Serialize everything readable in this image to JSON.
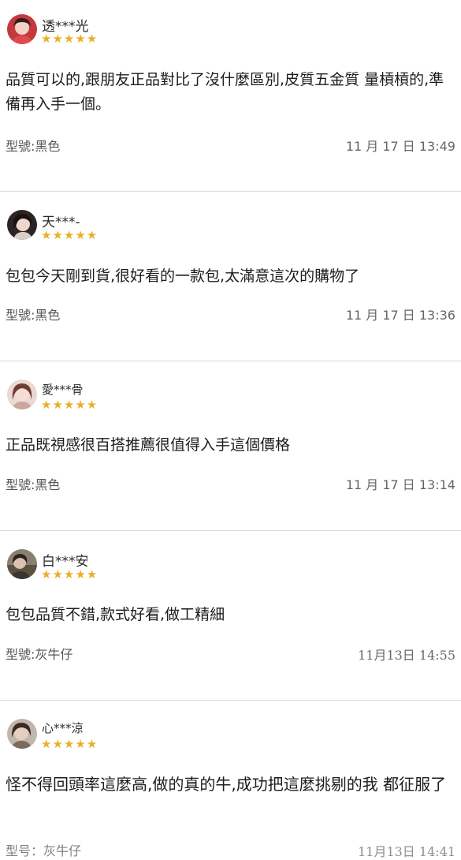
{
  "reviews": [
    {
      "username": "透***光",
      "stars": "★★★★★",
      "content": "品質可以的,跟朋友正品對比了沒什麼區別,皮質五金質 量槓槓的,準備再入手一個。",
      "model": "型號:黑色",
      "time": "11 月 17 日 13:49"
    },
    {
      "username": "天***-",
      "stars": "★★★★★",
      "content": "包包今天剛到貨,很好看的一款包,太滿意這次的購物了",
      "model": "型號:黑色",
      "time": "11 月 17 日 13:36"
    },
    {
      "username": "愛***骨",
      "stars": "★★★★★",
      "content": "正品既視感很百搭推薦很值得入手這個價格",
      "model": "型號:黑色",
      "time": "11 月 17 日 13:14"
    },
    {
      "username": "白***安",
      "stars": "★★★★★",
      "content": "包包品質不錯,款式好看,做工精細",
      "model": "型號:灰牛仔",
      "time": "11月13日 14:55"
    },
    {
      "username": "心***涼",
      "stars": "★★★★★",
      "content": "怪不得回頭率這麼高,做的真的牛,成功把這麼挑剔的我 都征服了",
      "model": "型号：灰牛仔",
      "time": "11月13日 14:41"
    }
  ],
  "colors": {
    "star": "#e8b028",
    "divider": "#dcdcdc",
    "text": "#1c1c1c",
    "meta": "#666666"
  }
}
